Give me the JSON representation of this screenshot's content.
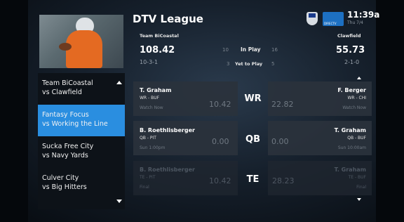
{
  "header": {
    "title": "DTV League",
    "time": "11:39a",
    "date": "Thu 7/4",
    "brand_label": "DIRECTV"
  },
  "matchup": {
    "left_team": "Team BiCoastal",
    "right_team": "Clawfield",
    "left_score": "108.42",
    "right_score": "55.73",
    "left_record": "10-3-1",
    "right_record": "2-1-0",
    "in_play_label": "In Play",
    "yet_label": "Yet to Play",
    "left_in_play": "10",
    "left_yet": "3",
    "right_in_play": "16",
    "right_yet": "5"
  },
  "sidebar": {
    "items": [
      {
        "line1": "Team BiCoastal",
        "line2": "vs Clawfield"
      },
      {
        "line1": "Fantasy Focus",
        "line2": "vs Working the Line"
      },
      {
        "line1": "Sucka Free City",
        "line2": "vs Navy Yards"
      },
      {
        "line1": "Culver City",
        "line2": "vs Big Hitters"
      }
    ]
  },
  "rows": [
    {
      "pos": "WR",
      "left": {
        "name": "T. Graham",
        "team": "WR - BUF",
        "status": "Watch Now",
        "score": "10.42"
      },
      "right": {
        "name": "F. Berger",
        "team": "WR - CHI",
        "status": "Watch Now",
        "score": "22.82"
      }
    },
    {
      "pos": "QB",
      "left": {
        "name": "B. Roethlisberger",
        "team": "QB - PIT",
        "status": "Sun 1:00pm",
        "score": "0.00"
      },
      "right": {
        "name": "T. Graham",
        "team": "QB - BUF",
        "status": "Sun 10:00am",
        "score": "0.00"
      }
    },
    {
      "pos": "TE",
      "left": {
        "name": "B. Roethlisberger",
        "team": "TE - PIT",
        "status": "Final",
        "score": "10.42"
      },
      "right": {
        "name": "T. Graham",
        "team": "TE - BUF",
        "status": "Final",
        "score": "28.23"
      }
    }
  ],
  "colors": {
    "accent": "#2a8ee0",
    "background": "#0a1018",
    "card": "#2a323c"
  }
}
